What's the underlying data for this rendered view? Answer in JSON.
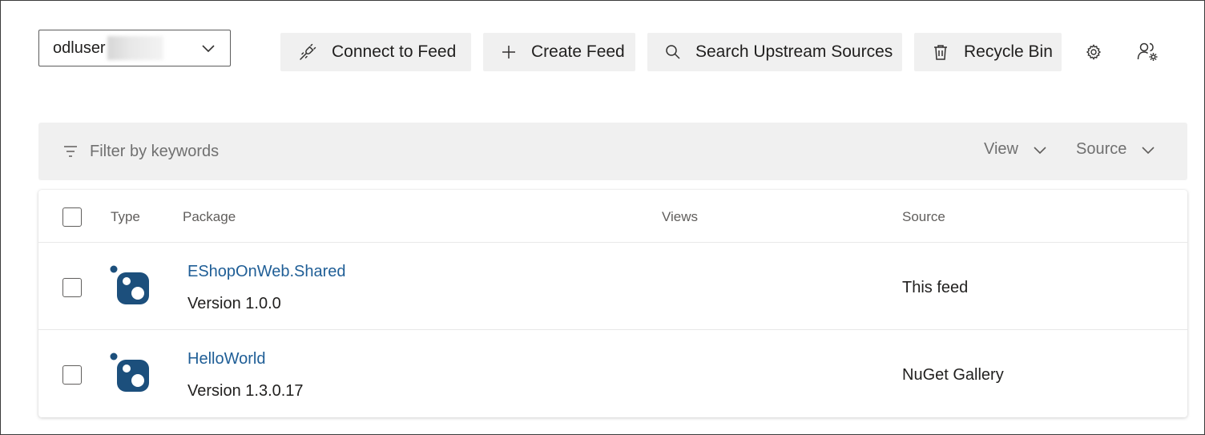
{
  "feed_selector": {
    "name": "odluser",
    "chevron_icon": "chevron-down-icon"
  },
  "toolbar": {
    "connect": {
      "label": "Connect to Feed",
      "icon": "plug-icon"
    },
    "create": {
      "label": "Create Feed",
      "icon": "plus-icon"
    },
    "search_upstream": {
      "label": "Search Upstream Sources",
      "icon": "search-icon"
    },
    "recycle": {
      "label": "Recycle Bin",
      "icon": "trash-icon"
    },
    "settings_icon": "gear-icon",
    "permissions_icon": "user-settings-icon"
  },
  "filter": {
    "placeholder": "Filter by keywords",
    "value": "",
    "icon": "filter-icon",
    "view_label": "View",
    "source_label": "Source"
  },
  "table": {
    "columns": {
      "type": "Type",
      "package": "Package",
      "views": "Views",
      "source": "Source"
    },
    "rows": [
      {
        "name": "EShopOnWeb.Shared",
        "version": "Version 1.0.0",
        "views": "",
        "source": "This feed",
        "icon": "nuget-package-icon"
      },
      {
        "name": "HelloWorld",
        "version": "Version 1.3.0.17",
        "views": "",
        "source": "NuGet Gallery",
        "icon": "nuget-package-icon"
      }
    ]
  },
  "colors": {
    "accent_link": "#1f5e96",
    "nuget_icon": "#1c4f7c",
    "toolbar_bg": "#f0f0f0",
    "text": "#201f1e"
  }
}
